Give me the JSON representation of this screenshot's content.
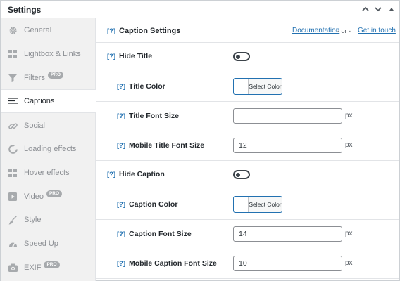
{
  "window": {
    "title": "Settings"
  },
  "sidebar": {
    "items": [
      {
        "label": "General",
        "icon": "gear-icon",
        "pro": false
      },
      {
        "label": "Lightbox & Links",
        "icon": "grid-icon",
        "pro": false
      },
      {
        "label": "Filters",
        "icon": "funnel-icon",
        "pro": true
      },
      {
        "label": "Captions",
        "icon": "captions-icon",
        "pro": false,
        "active": true
      },
      {
        "label": "Social",
        "icon": "link-icon",
        "pro": false
      },
      {
        "label": "Loading effects",
        "icon": "loading-icon",
        "pro": false
      },
      {
        "label": "Hover effects",
        "icon": "grid-icon",
        "pro": false
      },
      {
        "label": "Video",
        "icon": "video-icon",
        "pro": true
      },
      {
        "label": "Style",
        "icon": "brush-icon",
        "pro": false
      },
      {
        "label": "Speed Up",
        "icon": "speedometer-icon",
        "pro": false
      },
      {
        "label": "EXIF",
        "icon": "camera-icon",
        "pro": true
      }
    ],
    "pro_label": "PRO"
  },
  "header": {
    "help": "[?]",
    "title": "Caption Settings",
    "documentation": "Documentation",
    "separator": "- or -",
    "get_in_touch": "Get in touch"
  },
  "settings": {
    "help": "[?]",
    "unit": "px",
    "select_color": "Select Color",
    "hide_title": {
      "label": "Hide Title",
      "enabled": false
    },
    "title_color": {
      "label": "Title Color"
    },
    "title_font_size": {
      "label": "Title Font Size",
      "value": ""
    },
    "mobile_title_font_size": {
      "label": "Mobile Title Font Size",
      "value": "12"
    },
    "hide_caption": {
      "label": "Hide Caption",
      "enabled": false
    },
    "caption_color": {
      "label": "Caption Color"
    },
    "caption_font_size": {
      "label": "Caption Font Size",
      "value": "14"
    },
    "mobile_caption_font_size": {
      "label": "Mobile Caption Font Size",
      "value": "10"
    }
  },
  "colors": {
    "accent": "#2271b1",
    "sidebar_bg": "#f1f1f1",
    "muted": "#8c8f94"
  }
}
